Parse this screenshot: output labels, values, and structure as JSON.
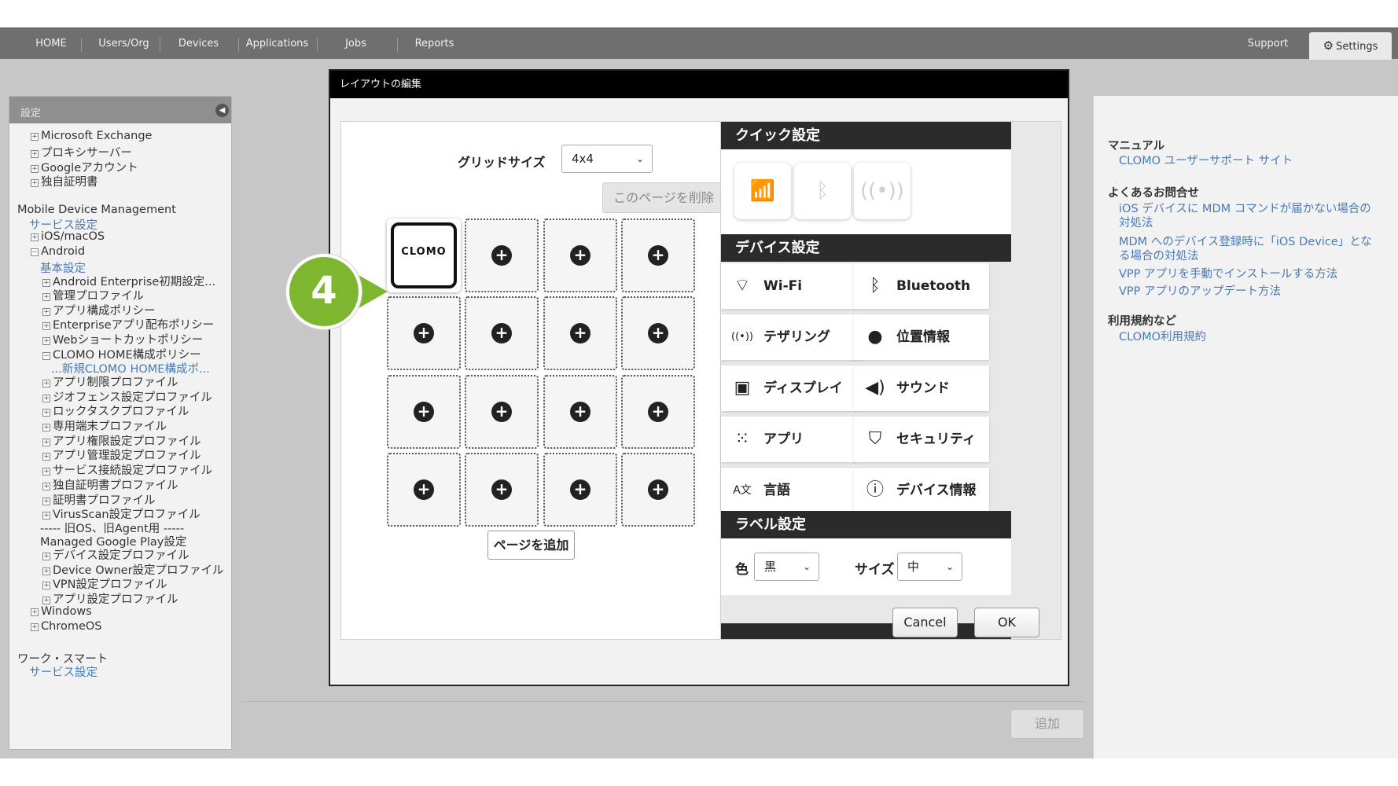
{
  "nav": {
    "items": [
      "HOME",
      "Users/Org",
      "Devices",
      "Applications",
      "Jobs",
      "Reports"
    ],
    "support": "Support",
    "settings": "Settings"
  },
  "sidebar": {
    "header": "設定",
    "items": [
      {
        "text": "Microsoft Exchange",
        "type": "pm"
      },
      {
        "text": "プロキシサーバー",
        "type": "pm"
      },
      {
        "text": "Googleアカウント",
        "type": "pm"
      },
      {
        "text": "独自証明書",
        "type": "pm"
      },
      {
        "text": "Mobile Device Management",
        "type": "head"
      },
      {
        "text": "サービス設定",
        "type": "link"
      },
      {
        "text": "iOS/macOS",
        "type": "pm"
      },
      {
        "text": "Android",
        "type": "minus"
      },
      {
        "text": "基本設定",
        "type": "link"
      },
      {
        "text": "Android Enterprise初期設定...",
        "type": "pm"
      },
      {
        "text": "管理プロファイル",
        "type": "pm"
      },
      {
        "text": "アプリ構成ポリシー",
        "type": "pm"
      },
      {
        "text": "Enterpriseアプリ配布ポリシー",
        "type": "pm"
      },
      {
        "text": "Webショートカットポリシー",
        "type": "pm"
      },
      {
        "text": "CLOMO HOME構成ポリシー",
        "type": "minus"
      },
      {
        "text": "...新規CLOMO HOME構成ポ...",
        "type": "link"
      },
      {
        "text": "アプリ制限プロファイル",
        "type": "pm"
      },
      {
        "text": "ジオフェンス設定プロファイル",
        "type": "pm"
      },
      {
        "text": "ロックタスクプロファイル",
        "type": "pm"
      },
      {
        "text": "専用端末プロファイル",
        "type": "pm"
      },
      {
        "text": "アプリ権限設定プロファイル",
        "type": "pm"
      },
      {
        "text": "アプリ管理設定プロファイル",
        "type": "pm"
      },
      {
        "text": "サービス接続設定プロファイル",
        "type": "pm"
      },
      {
        "text": "独自証明書プロファイル",
        "type": "pm"
      },
      {
        "text": "証明書プロファイル",
        "type": "pm"
      },
      {
        "text": "VirusScan設定プロファイル",
        "type": "pm"
      },
      {
        "text": "----- 旧OS、旧Agent用 -----",
        "type": "plain"
      },
      {
        "text": "Managed Google Play設定",
        "type": "plain"
      },
      {
        "text": "デバイス設定プロファイル",
        "type": "pm"
      },
      {
        "text": "Device Owner設定プロファイル",
        "type": "pm"
      },
      {
        "text": "VPN設定プロファイル",
        "type": "pm"
      },
      {
        "text": "アプリ設定プロファイル",
        "type": "pm"
      },
      {
        "text": "Windows",
        "type": "pm"
      },
      {
        "text": "ChromeOS",
        "type": "pm"
      },
      {
        "text": "ワーク・スマート",
        "type": "head"
      },
      {
        "text": "サービス設定",
        "type": "link"
      }
    ]
  },
  "rightpanel": {
    "manual_h": "マニュアル",
    "manual_link": "CLOMO ユーザーサポート サイト",
    "faq_h": "よくあるお問合せ",
    "faq_links": [
      "iOS デバイスに MDM コマンドが届かない場合の対処法",
      "MDM へのデバイス登録時に「iOS Device」となる場合の対処法",
      "VPP アプリを手動でインストールする方法",
      "VPP アプリのアップデート方法"
    ],
    "terms_h": "利用規約など",
    "terms_link": "CLOMO利用規約"
  },
  "main": {
    "add": "追加"
  },
  "modal": {
    "title": "レイアウトの編集",
    "grid_label": "グリッドサイズ",
    "grid_value": "4x4",
    "delete_page": "このページを削除",
    "add_page": "ページを追加",
    "clomo_logo": "CLOMO",
    "cancel": "Cancel",
    "ok": "OK",
    "quick_h": "クイック設定",
    "device_h": "デバイス設定",
    "label_h": "ラベル設定",
    "label_color": "色",
    "label_color_value": "黒",
    "label_size": "サイズ",
    "label_size_value": "中",
    "device_buttons": [
      {
        "label": "Wi-Fi",
        "icon": "wifi-icon"
      },
      {
        "label": "Bluetooth",
        "icon": "bluetooth-icon"
      },
      {
        "label": "テザリング",
        "icon": "tethering-icon"
      },
      {
        "label": "位置情報",
        "icon": "location-icon"
      },
      {
        "label": "ディスプレイ",
        "icon": "display-icon"
      },
      {
        "label": "サウンド",
        "icon": "sound-icon"
      },
      {
        "label": "アプリ",
        "icon": "apps-icon"
      },
      {
        "label": "セキュリティ",
        "icon": "security-icon"
      },
      {
        "label": "言語",
        "icon": "language-icon"
      },
      {
        "label": "デバイス情報",
        "icon": "info-icon"
      }
    ]
  },
  "callout": {
    "number": "4"
  },
  "colors": {
    "accent_green": "#7db72f",
    "link": "#4a79b5",
    "nav": "#6f6f6f"
  }
}
